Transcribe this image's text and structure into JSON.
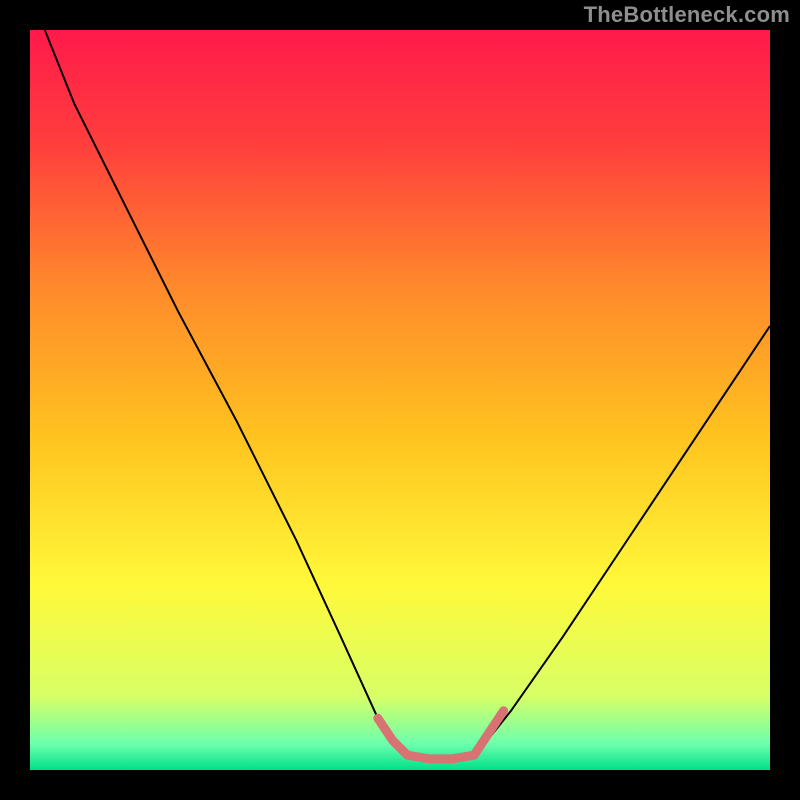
{
  "watermark": "TheBottleneck.com",
  "chart_data": {
    "type": "line",
    "title": "",
    "xlabel": "",
    "ylabel": "",
    "xlim": [
      0,
      100
    ],
    "ylim": [
      0,
      100
    ],
    "grid": false,
    "legend": false,
    "gradient_stops": [
      {
        "offset": 0.0,
        "color": "#ff1a4b"
      },
      {
        "offset": 0.15,
        "color": "#ff3d3d"
      },
      {
        "offset": 0.35,
        "color": "#ff8a2b"
      },
      {
        "offset": 0.55,
        "color": "#ffc31f"
      },
      {
        "offset": 0.75,
        "color": "#fff93a"
      },
      {
        "offset": 0.9,
        "color": "#d8ff66"
      },
      {
        "offset": 0.965,
        "color": "#6cffad"
      },
      {
        "offset": 1.0,
        "color": "#00e08a"
      }
    ],
    "series": [
      {
        "name": "bottleneck-curve",
        "stroke": "#000000",
        "points": [
          {
            "x": 2.0,
            "y": 100.0
          },
          {
            "x": 6.0,
            "y": 90.0
          },
          {
            "x": 12.0,
            "y": 78.0
          },
          {
            "x": 20.0,
            "y": 62.0
          },
          {
            "x": 28.0,
            "y": 47.0
          },
          {
            "x": 36.0,
            "y": 31.0
          },
          {
            "x": 42.0,
            "y": 18.0
          },
          {
            "x": 47.0,
            "y": 7.0
          },
          {
            "x": 50.0,
            "y": 3.0
          },
          {
            "x": 53.0,
            "y": 1.5
          },
          {
            "x": 58.0,
            "y": 1.5
          },
          {
            "x": 61.0,
            "y": 3.0
          },
          {
            "x": 65.0,
            "y": 8.0
          },
          {
            "x": 72.0,
            "y": 18.0
          },
          {
            "x": 80.0,
            "y": 30.0
          },
          {
            "x": 88.0,
            "y": 42.0
          },
          {
            "x": 96.0,
            "y": 54.0
          },
          {
            "x": 100.0,
            "y": 60.0
          }
        ]
      },
      {
        "name": "highlight-band",
        "stroke": "#d97272",
        "stroke_width": 9,
        "linecap": "round",
        "points": [
          {
            "x": 47.0,
            "y": 7.0
          },
          {
            "x": 49.0,
            "y": 4.0
          },
          {
            "x": 51.0,
            "y": 2.0
          },
          {
            "x": 54.0,
            "y": 1.5
          },
          {
            "x": 57.0,
            "y": 1.5
          },
          {
            "x": 60.0,
            "y": 2.0
          },
          {
            "x": 62.0,
            "y": 5.0
          },
          {
            "x": 64.0,
            "y": 8.0
          }
        ]
      }
    ]
  }
}
